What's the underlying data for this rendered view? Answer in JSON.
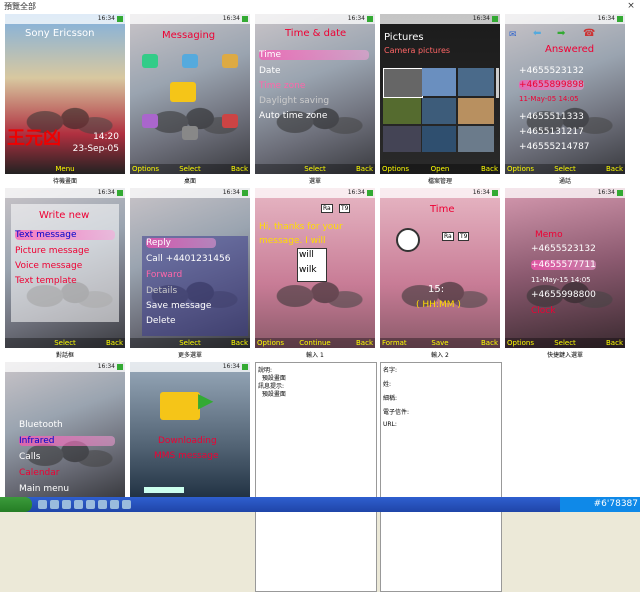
{
  "window": {
    "title": "預覽全部",
    "close_glyph": "×"
  },
  "status_time": "16:34",
  "cells": [
    {
      "caption": "待機畫面",
      "texts": {
        "brand": "Sony Ericsson",
        "clock": "14:20",
        "date": "23-Sep-05"
      },
      "softkeys": {
        "left": "",
        "center": "Menu",
        "right": ""
      }
    },
    {
      "caption": "桌面",
      "texts": {
        "title": "Messaging"
      },
      "softkeys": {
        "left": "Options",
        "center": "Select",
        "right": "Back"
      }
    },
    {
      "caption": "選單",
      "texts": {
        "title": "Time & date"
      },
      "items": [
        "Time",
        "Date",
        "Time zone",
        "Daylight saving",
        "Auto time zone"
      ],
      "softkeys": {
        "left": "",
        "center": "Select",
        "right": "Back"
      }
    },
    {
      "caption": "檔案管理",
      "texts": {
        "title": "Pictures",
        "sub": "Camera pictures"
      },
      "softkeys": {
        "left": "Options",
        "center": "Open",
        "right": "Back"
      }
    },
    {
      "caption": "通話",
      "texts": {
        "title": "Answered"
      },
      "items": [
        "+4655523132",
        "+4655899898",
        "11-May-05    14:05",
        "+4655511333",
        "+4655131217",
        "+46555214787"
      ],
      "softkeys": {
        "left": "Options",
        "center": "Select",
        "right": "Back"
      }
    },
    {
      "caption": "對話框",
      "texts": {
        "title": "Write new"
      },
      "items": [
        "Text message",
        "Picture message",
        "Voice message",
        "Text template"
      ],
      "softkeys": {
        "left": "",
        "center": "Select",
        "right": "Back"
      }
    },
    {
      "caption": "更多選單",
      "texts": {},
      "items": [
        "Reply",
        "Call +4401231456",
        "Forward",
        "Details",
        "Save message",
        "Delete"
      ],
      "softkeys": {
        "left": "",
        "center": "Select",
        "right": "Back"
      }
    },
    {
      "caption": "輸入 1",
      "texts": {
        "line1": "Hi, thanks for your",
        "line2": "message. I will"
      },
      "items": [
        "will",
        "wilk"
      ],
      "softkeys": {
        "left": "Options",
        "center": "Continue",
        "right": "Back"
      }
    },
    {
      "caption": "輸入 2",
      "texts": {
        "title": "Time",
        "value": "15:  ",
        "hint": "( HH:MM )"
      },
      "softkeys": {
        "left": "Format",
        "center": "Save",
        "right": "Back"
      }
    },
    {
      "caption": "快捷鍵入選單",
      "texts": {},
      "items": [
        "Memo",
        "+4655523132",
        "+4655577711",
        "11-May-15  14:05",
        "+4655998800",
        "Clock"
      ],
      "softkeys": {
        "left": "Options",
        "center": "Select",
        "right": "Back"
      }
    },
    {
      "caption": "",
      "texts": {},
      "items": [
        "Bluetooth",
        "Infrared",
        "Calls",
        "Calendar",
        "Main menu"
      ],
      "softkeys": {
        "left": "",
        "center": "",
        "right": ""
      }
    },
    {
      "caption": "",
      "texts": {
        "line1": "Downloading",
        "line2": "MMS message"
      },
      "softkeys": {
        "left": "",
        "center": "",
        "right": ""
      }
    }
  ],
  "panel_left": {
    "lines": [
      "說明:",
      "  預設畫面",
      "訊息提示:",
      "  預設畫面"
    ]
  },
  "panel_right": {
    "lines": [
      "名字:",
      "姓:",
      "細稱:",
      "電子信件:",
      "URL:"
    ]
  },
  "tray": {
    "text": "#6'78387"
  },
  "colors": {
    "accent": "#e03050",
    "softkey": "#ffff00",
    "taskbar": "#1f45a8"
  }
}
